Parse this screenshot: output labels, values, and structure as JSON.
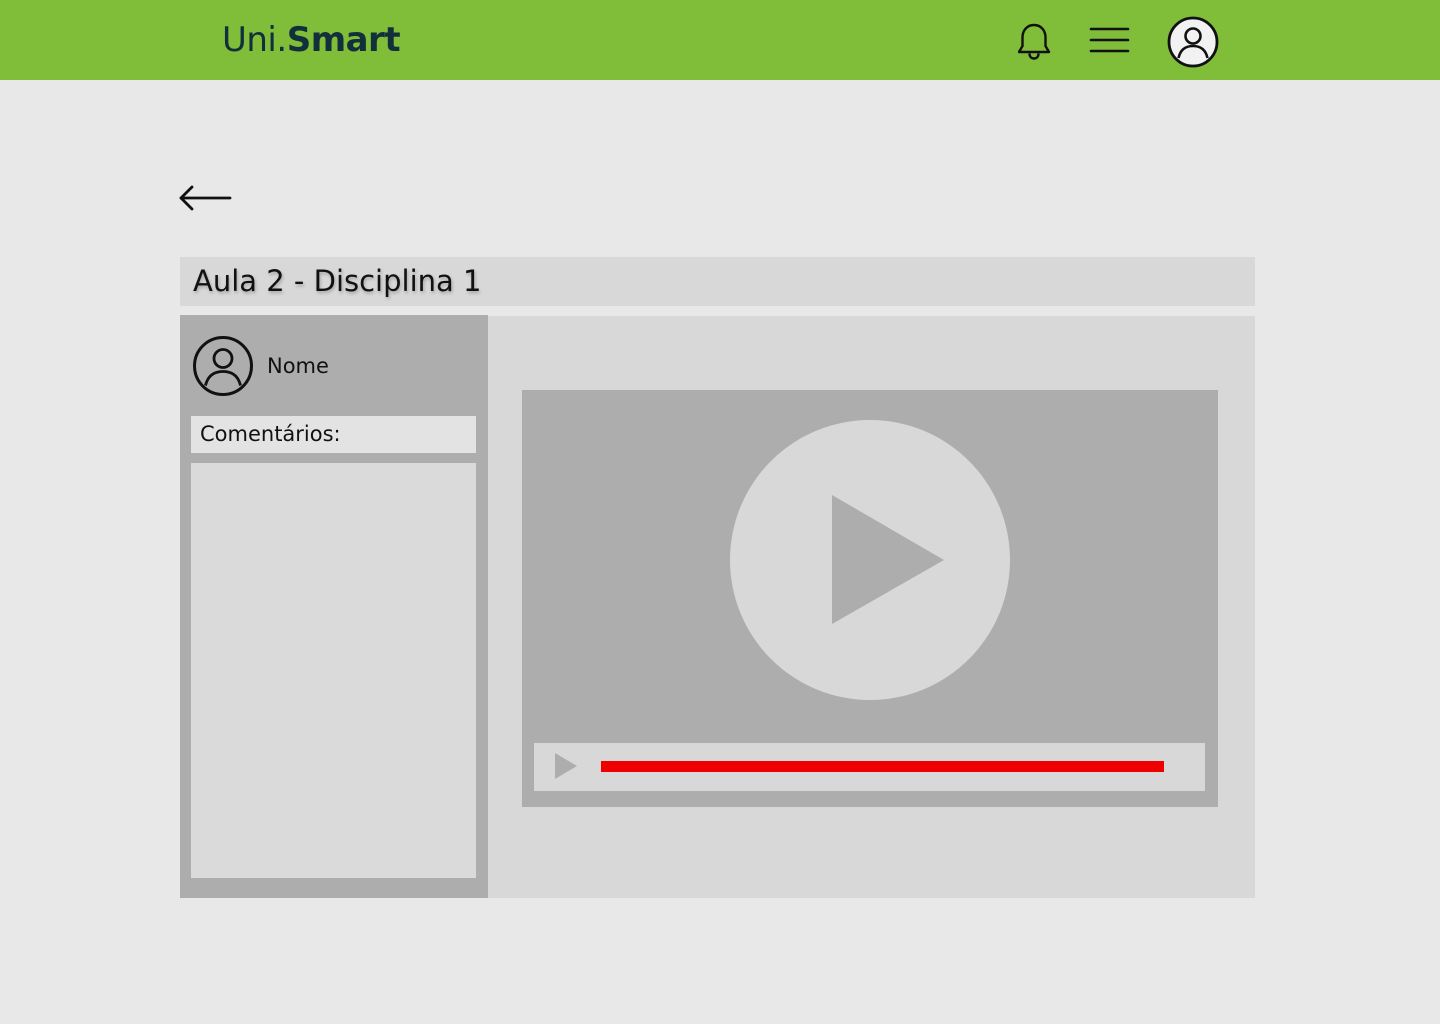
{
  "header": {
    "logo_prefix": "Uni.",
    "logo_brand": "Smart",
    "icons": [
      "bell-icon",
      "menu-icon",
      "user-profile-icon"
    ],
    "background_color": "#80bd38",
    "logo_color": "#12303b"
  },
  "navigation": {
    "back_icon": "arrow-left-icon"
  },
  "lesson": {
    "title": "Aula 2 - Disciplina 1"
  },
  "sidebar": {
    "user_name": "Nome",
    "avatar_icon": "user-avatar-icon",
    "comments_label": "Comentários:"
  },
  "video": {
    "big_play_icon": "play-circle-icon",
    "small_play_icon": "play-icon",
    "progress": 1.0,
    "progress_color": "#ee0000"
  }
}
